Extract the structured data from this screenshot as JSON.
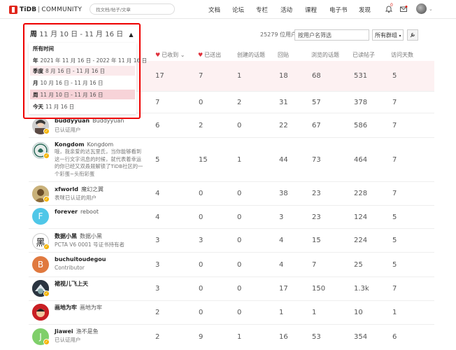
{
  "header": {
    "logo_brand": "TiDB",
    "logo_community": "COMMUNITY",
    "search_placeholder": "找文档/帖子/文章",
    "nav": [
      "文档",
      "论坛",
      "专栏",
      "活动",
      "课程",
      "电子书",
      "发现"
    ],
    "notification_count": "0",
    "colors": {
      "brand": "#e1251b"
    }
  },
  "filter": {
    "period_label": "周",
    "period_range": "11 月 10 日 - 11 月 16 日",
    "users_count": "25279 位用户",
    "filter_placeholder": "按用户名筛选",
    "group_select": "所有群组"
  },
  "period_dropdown": {
    "items": [
      {
        "label": "所有时间",
        "range": ""
      },
      {
        "label": "年",
        "range": "2021 年 11 月 16 日 - 2022 年 11 月 16 日"
      },
      {
        "label": "季度",
        "range": "8 月 16 日 - 11 月 16 日"
      },
      {
        "label": "月",
        "range": "10 月 16 日 - 11 月 16 日"
      },
      {
        "label": "周",
        "range": "11 月 10 日 - 11 月 16 日"
      },
      {
        "label": "今天",
        "range": "11 月 16 日"
      }
    ],
    "selected": "周"
  },
  "table": {
    "headers": [
      "已收到",
      "已送出",
      "创建的话题",
      "回贴",
      "浏览的话题",
      "已读帖子",
      "访问天数"
    ],
    "rows": [
      {
        "username": "",
        "fullname": "",
        "title": "",
        "values": [
          "17",
          "7",
          "1",
          "18",
          "68",
          "531",
          "5"
        ]
      },
      {
        "username": "",
        "fullname": "",
        "title": "",
        "values": [
          "7",
          "0",
          "2",
          "31",
          "57",
          "378",
          "7"
        ]
      },
      {
        "username": "buddyyuan",
        "fullname": "Buddyyuan",
        "title": "已认证用户",
        "values": [
          "6",
          "2",
          "0",
          "22",
          "67",
          "586",
          "7"
        ]
      },
      {
        "username": "Kongdom",
        "fullname": "Kongdom",
        "title": "",
        "bio": "哦，我亲爱的达瓦里氏，当你能够看到这一行文字讯息的时候，就代表着幸运的你已经又双叒叕解锁了TiDB社区的一个彩蛋~头衔彩蛋",
        "values": [
          "5",
          "15",
          "1",
          "44",
          "73",
          "464",
          "7"
        ]
      },
      {
        "username": "xfworld",
        "fullname": "魔幻之翼",
        "title": "表咪已认证的用户",
        "values": [
          "4",
          "0",
          "0",
          "38",
          "23",
          "228",
          "7"
        ]
      },
      {
        "username": "forever",
        "fullname": "reboot",
        "title": "",
        "values": [
          "4",
          "0",
          "0",
          "3",
          "23",
          "124",
          "5"
        ]
      },
      {
        "username": "数据小黑",
        "fullname": "数据小黑",
        "title": "PCTA V6 0001 号证书持有者",
        "values": [
          "3",
          "3",
          "0",
          "4",
          "15",
          "224",
          "5"
        ]
      },
      {
        "username": "buchuitoudegou",
        "fullname": "",
        "title": "Contributor",
        "values": [
          "3",
          "0",
          "0",
          "4",
          "7",
          "25",
          "5"
        ]
      },
      {
        "username": "裙视儿飞上天",
        "fullname": "",
        "title": "",
        "values": [
          "3",
          "0",
          "0",
          "17",
          "150",
          "1.3k",
          "7"
        ]
      },
      {
        "username": "画地为牢",
        "fullname": "画地为牢",
        "title": "",
        "values": [
          "2",
          "0",
          "0",
          "1",
          "1",
          "10",
          "1"
        ]
      },
      {
        "username": "Jiawei",
        "fullname": "渔不是鱼",
        "title": "已认证用户",
        "values": [
          "2",
          "9",
          "1",
          "16",
          "53",
          "354",
          "6"
        ]
      }
    ]
  }
}
